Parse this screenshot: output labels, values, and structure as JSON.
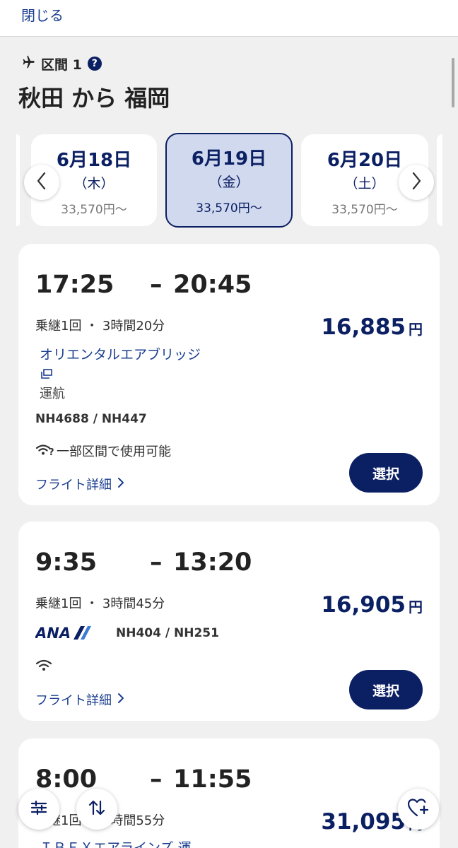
{
  "header": {
    "close_label": "閉じる"
  },
  "segment": {
    "label": "区間 1",
    "help_glyph": "?",
    "route": "秋田 から 福岡"
  },
  "dates": [
    {
      "date": "6月18日",
      "day": "（木）",
      "price": "33,570円〜",
      "selected": false
    },
    {
      "date": "6月19日",
      "day": "（金）",
      "price": "33,570円〜",
      "selected": true
    },
    {
      "date": "6月20日",
      "day": "（土）",
      "price": "33,570円〜",
      "selected": false
    }
  ],
  "flights": [
    {
      "depart": "17:25",
      "dash": "–",
      "arrive": "20:45",
      "stops": "乗継1回 ・ 3時間20分",
      "price": "16,885",
      "currency": "円",
      "operator": "オリエンタルエアブリッジ",
      "operated_label": "運航",
      "flight_numbers": "NH4688 / NH447",
      "wifi": "一部区間で使用可能",
      "details_label": "フライト詳細",
      "select_label": "選択"
    },
    {
      "depart": "9:35",
      "dash": "–",
      "arrive": "13:20",
      "stops": "乗継1回 ・ 3時間45分",
      "price": "16,905",
      "currency": "円",
      "airline_logo_text": "ANA",
      "flight_numbers": "NH404 / NH251",
      "details_label": "フライト詳細",
      "select_label": "選択"
    },
    {
      "depart": "8:00",
      "dash": "–",
      "arrive": "11:55",
      "stops": "乗継1回 ・ 3時間55分",
      "price": "31,095",
      "currency": "円",
      "operator_partial": "ＩＢＥＸエアラインズ 運"
    }
  ],
  "colors": {
    "brand_navy": "#0b1f63",
    "link_blue": "#1a3d8f",
    "selected_bg": "#d1d9ef",
    "page_bg": "#f0f0f0"
  },
  "icons": {
    "segment": "airplane-icon",
    "help": "help-circle-icon",
    "prev": "chevron-left-icon",
    "next": "chevron-right-icon",
    "operated_by": "external-window-icon",
    "wifi_partial": "wifi-partial-icon",
    "wifi": "wifi-icon",
    "filter": "filter-sliders-icon",
    "sort": "sort-arrows-icon",
    "favorite": "heart-plus-icon"
  }
}
